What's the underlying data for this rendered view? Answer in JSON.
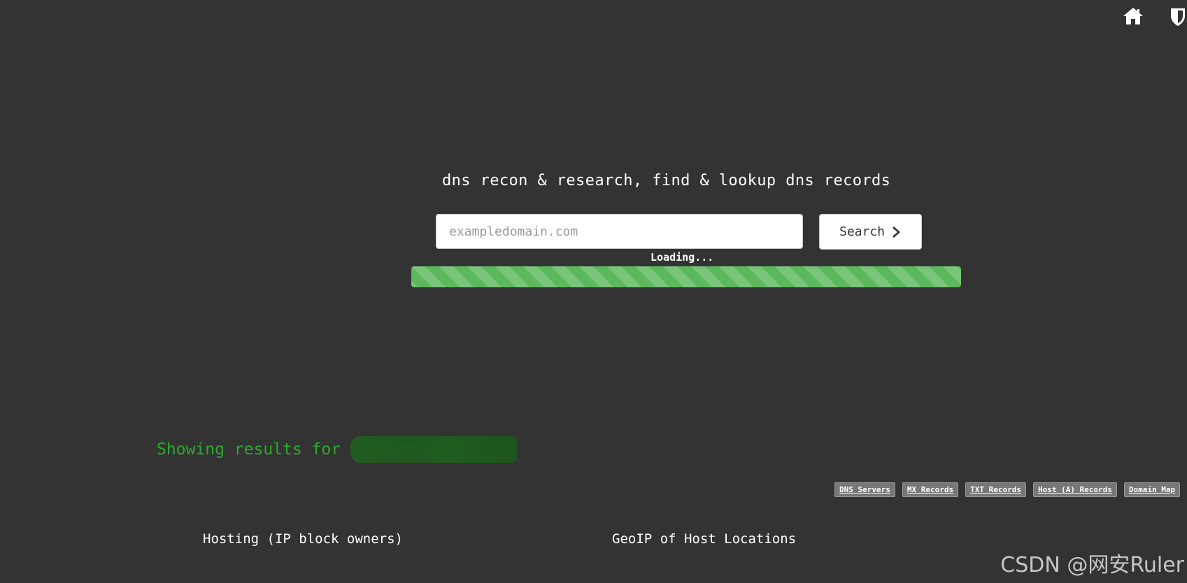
{
  "nav": {
    "home_icon": "home-icon",
    "shield_icon": "shield-icon"
  },
  "hero": {
    "tagline": "dns recon & research, find & lookup dns records"
  },
  "search": {
    "placeholder": "exampledomain.com",
    "value": "",
    "button_label": "Search",
    "button_icon": "chevron-right-icon"
  },
  "loading": {
    "text": "Loading...",
    "progress_percent": 100,
    "color": "#5cb85c"
  },
  "results": {
    "prefix": "Showing results for",
    "domain_redacted": true,
    "color": "#2eaa2e"
  },
  "record_tabs": [
    {
      "label": "DNS Servers"
    },
    {
      "label": "MX Records"
    },
    {
      "label": "TXT Records"
    },
    {
      "label": "Host (A) Records"
    },
    {
      "label": "Domain Map"
    }
  ],
  "sections": {
    "hosting": "Hosting (IP block owners)",
    "geoip": "GeoIP of Host Locations"
  },
  "watermark": "CSDN @网安Ruler",
  "colors": {
    "background": "#333333",
    "accent_green": "#5cb85c",
    "results_green": "#2eaa2e"
  }
}
